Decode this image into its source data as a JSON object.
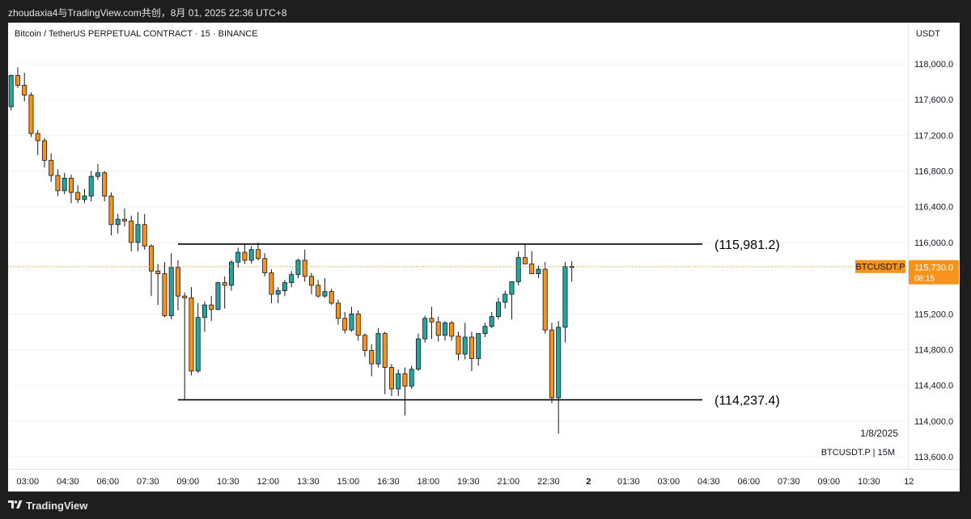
{
  "header": {
    "caption": "zhoudaxia4与TradingView.com共创，8月 01, 2025 22:36 UTC+8"
  },
  "chart_title": "Bitcoin / TetherUS PERPETUAL CONTRACT · 15 · BINANCE",
  "footer": {
    "brand": "TradingView"
  },
  "chart_data": {
    "type": "candlestick",
    "symbol": "BTCUSDT.P",
    "interval_label": "BTCUSDT.P | 15M",
    "currency": "USDT",
    "date_label": "1/8/2025",
    "last_price": {
      "value": 115730.0,
      "label": "115,730.0",
      "countdown": "08:15"
    },
    "y_ticks": [
      {
        "value": 118000,
        "label": "118,000.0"
      },
      {
        "value": 117600,
        "label": "117,600.0"
      },
      {
        "value": 117200,
        "label": "117,200.0"
      },
      {
        "value": 116800,
        "label": "116,800.0"
      },
      {
        "value": 116400,
        "label": "116,400.0"
      },
      {
        "value": 116000,
        "label": "116,000.0"
      },
      {
        "value": 115200,
        "label": "115,200.0"
      },
      {
        "value": 114800,
        "label": "114,800.0"
      },
      {
        "value": 114400,
        "label": "114,400.0"
      },
      {
        "value": 114000,
        "label": "114,000.0"
      },
      {
        "value": 113600,
        "label": "113,600.0"
      }
    ],
    "x_ticks": [
      {
        "index": 2.5,
        "label": "03:00",
        "bold": false
      },
      {
        "index": 8.5,
        "label": "04:30",
        "bold": false
      },
      {
        "index": 14.5,
        "label": "06:00",
        "bold": false
      },
      {
        "index": 20.5,
        "label": "07:30",
        "bold": false
      },
      {
        "index": 26.5,
        "label": "09:00",
        "bold": false
      },
      {
        "index": 32.5,
        "label": "10:30",
        "bold": false
      },
      {
        "index": 38.5,
        "label": "12:00",
        "bold": false
      },
      {
        "index": 44.5,
        "label": "13:30",
        "bold": false
      },
      {
        "index": 50.5,
        "label": "15:00",
        "bold": false
      },
      {
        "index": 56.5,
        "label": "16:30",
        "bold": false
      },
      {
        "index": 62.5,
        "label": "18:00",
        "bold": false
      },
      {
        "index": 68.5,
        "label": "19:30",
        "bold": false
      },
      {
        "index": 74.5,
        "label": "21:00",
        "bold": false
      },
      {
        "index": 80.5,
        "label": "22:30",
        "bold": false
      },
      {
        "index": 86.5,
        "label": "2",
        "bold": true
      },
      {
        "index": 92.5,
        "label": "01:30",
        "bold": false
      },
      {
        "index": 98.5,
        "label": "03:00",
        "bold": false
      },
      {
        "index": 104.5,
        "label": "04:30",
        "bold": false
      },
      {
        "index": 110.5,
        "label": "06:00",
        "bold": false
      },
      {
        "index": 116.5,
        "label": "07:30",
        "bold": false
      },
      {
        "index": 122.5,
        "label": "09:00",
        "bold": false
      },
      {
        "index": 128.5,
        "label": "10:30",
        "bold": false
      },
      {
        "index": 134.5,
        "label": "12",
        "bold": false
      }
    ],
    "levels": [
      {
        "value": 115981.2,
        "label": "(115,981.2)",
        "from_index": 25
      },
      {
        "value": 114237.4,
        "label": "(114,237.4)",
        "from_index": 25
      }
    ],
    "candles": [
      {
        "o": 117520,
        "h": 117880,
        "l": 117480,
        "c": 117870
      },
      {
        "o": 117870,
        "h": 117960,
        "l": 117730,
        "c": 117760
      },
      {
        "o": 117760,
        "h": 117900,
        "l": 117580,
        "c": 117650
      },
      {
        "o": 117650,
        "h": 117680,
        "l": 117180,
        "c": 117220
      },
      {
        "o": 117220,
        "h": 117260,
        "l": 116980,
        "c": 117140
      },
      {
        "o": 117140,
        "h": 117170,
        "l": 116840,
        "c": 116920
      },
      {
        "o": 116920,
        "h": 117000,
        "l": 116680,
        "c": 116750
      },
      {
        "o": 116750,
        "h": 116820,
        "l": 116520,
        "c": 116580
      },
      {
        "o": 116580,
        "h": 116780,
        "l": 116540,
        "c": 116720
      },
      {
        "o": 116720,
        "h": 116760,
        "l": 116440,
        "c": 116560
      },
      {
        "o": 116560,
        "h": 116640,
        "l": 116440,
        "c": 116480
      },
      {
        "o": 116480,
        "h": 116600,
        "l": 116440,
        "c": 116520
      },
      {
        "o": 116520,
        "h": 116800,
        "l": 116460,
        "c": 116740
      },
      {
        "o": 116740,
        "h": 116880,
        "l": 116700,
        "c": 116780
      },
      {
        "o": 116780,
        "h": 116800,
        "l": 116460,
        "c": 116520
      },
      {
        "o": 116520,
        "h": 116560,
        "l": 116080,
        "c": 116200
      },
      {
        "o": 116200,
        "h": 116320,
        "l": 116100,
        "c": 116260
      },
      {
        "o": 116260,
        "h": 116380,
        "l": 116180,
        "c": 116240
      },
      {
        "o": 116240,
        "h": 116300,
        "l": 115900,
        "c": 116000
      },
      {
        "o": 116000,
        "h": 116340,
        "l": 115900,
        "c": 116200
      },
      {
        "o": 116200,
        "h": 116320,
        "l": 115920,
        "c": 115960
      },
      {
        "o": 115960,
        "h": 115980,
        "l": 115400,
        "c": 115680
      },
      {
        "o": 115680,
        "h": 115760,
        "l": 115300,
        "c": 115650
      },
      {
        "o": 115650,
        "h": 115780,
        "l": 115160,
        "c": 115180
      },
      {
        "o": 115180,
        "h": 115880,
        "l": 115140,
        "c": 115720
      },
      {
        "o": 115720,
        "h": 115800,
        "l": 115240,
        "c": 115400
      },
      {
        "o": 115400,
        "h": 115440,
        "l": 114240,
        "c": 115380
      },
      {
        "o": 115380,
        "h": 115500,
        "l": 114510,
        "c": 114560
      },
      {
        "o": 114560,
        "h": 115320,
        "l": 114540,
        "c": 115160
      },
      {
        "o": 115160,
        "h": 115340,
        "l": 115000,
        "c": 115300
      },
      {
        "o": 115300,
        "h": 115400,
        "l": 115120,
        "c": 115250
      },
      {
        "o": 115250,
        "h": 115560,
        "l": 115240,
        "c": 115550
      },
      {
        "o": 115550,
        "h": 115620,
        "l": 115260,
        "c": 115520
      },
      {
        "o": 115520,
        "h": 115800,
        "l": 115460,
        "c": 115780
      },
      {
        "o": 115780,
        "h": 115940,
        "l": 115720,
        "c": 115890
      },
      {
        "o": 115890,
        "h": 115980,
        "l": 115760,
        "c": 115800
      },
      {
        "o": 115800,
        "h": 115960,
        "l": 115760,
        "c": 115920
      },
      {
        "o": 115920,
        "h": 116000,
        "l": 115800,
        "c": 115820
      },
      {
        "o": 115820,
        "h": 115880,
        "l": 115620,
        "c": 115660
      },
      {
        "o": 115660,
        "h": 115700,
        "l": 115320,
        "c": 115420
      },
      {
        "o": 115420,
        "h": 115500,
        "l": 115320,
        "c": 115460
      },
      {
        "o": 115460,
        "h": 115580,
        "l": 115400,
        "c": 115550
      },
      {
        "o": 115550,
        "h": 115680,
        "l": 115500,
        "c": 115640
      },
      {
        "o": 115640,
        "h": 115820,
        "l": 115600,
        "c": 115800
      },
      {
        "o": 115800,
        "h": 115920,
        "l": 115560,
        "c": 115620
      },
      {
        "o": 115620,
        "h": 115660,
        "l": 115420,
        "c": 115520
      },
      {
        "o": 115520,
        "h": 115580,
        "l": 115380,
        "c": 115400
      },
      {
        "o": 115400,
        "h": 115600,
        "l": 115380,
        "c": 115450
      },
      {
        "o": 115450,
        "h": 115480,
        "l": 115300,
        "c": 115320
      },
      {
        "o": 115320,
        "h": 115360,
        "l": 115080,
        "c": 115150
      },
      {
        "o": 115150,
        "h": 115220,
        "l": 114980,
        "c": 115020
      },
      {
        "o": 115020,
        "h": 115280,
        "l": 115000,
        "c": 115200
      },
      {
        "o": 115200,
        "h": 115240,
        "l": 114900,
        "c": 114960
      },
      {
        "o": 114960,
        "h": 114980,
        "l": 114720,
        "c": 114790
      },
      {
        "o": 114790,
        "h": 114860,
        "l": 114500,
        "c": 114640
      },
      {
        "o": 114640,
        "h": 115040,
        "l": 114600,
        "c": 114980
      },
      {
        "o": 114980,
        "h": 115000,
        "l": 114300,
        "c": 114600
      },
      {
        "o": 114600,
        "h": 114640,
        "l": 114280,
        "c": 114360
      },
      {
        "o": 114360,
        "h": 114580,
        "l": 114280,
        "c": 114530
      },
      {
        "o": 114530,
        "h": 114600,
        "l": 114060,
        "c": 114390
      },
      {
        "o": 114390,
        "h": 114620,
        "l": 114360,
        "c": 114580
      },
      {
        "o": 114580,
        "h": 114980,
        "l": 114560,
        "c": 114920
      },
      {
        "o": 114920,
        "h": 115180,
        "l": 114880,
        "c": 115150
      },
      {
        "o": 115150,
        "h": 115280,
        "l": 114920,
        "c": 115110
      },
      {
        "o": 115110,
        "h": 115170,
        "l": 114890,
        "c": 114960
      },
      {
        "o": 114960,
        "h": 115120,
        "l": 114900,
        "c": 115100
      },
      {
        "o": 115100,
        "h": 115120,
        "l": 114900,
        "c": 114950
      },
      {
        "o": 114950,
        "h": 115000,
        "l": 114680,
        "c": 114750
      },
      {
        "o": 114750,
        "h": 115100,
        "l": 114690,
        "c": 114940
      },
      {
        "o": 114940,
        "h": 115000,
        "l": 114560,
        "c": 114700
      },
      {
        "o": 114700,
        "h": 114980,
        "l": 114620,
        "c": 114980
      },
      {
        "o": 114980,
        "h": 115100,
        "l": 114940,
        "c": 115060
      },
      {
        "o": 115060,
        "h": 115220,
        "l": 115040,
        "c": 115170
      },
      {
        "o": 115170,
        "h": 115380,
        "l": 115140,
        "c": 115330
      },
      {
        "o": 115330,
        "h": 115460,
        "l": 115260,
        "c": 115420
      },
      {
        "o": 115420,
        "h": 115520,
        "l": 115140,
        "c": 115560
      },
      {
        "o": 115560,
        "h": 115900,
        "l": 115520,
        "c": 115830
      },
      {
        "o": 115830,
        "h": 115980,
        "l": 115780,
        "c": 115760
      },
      {
        "o": 115760,
        "h": 115900,
        "l": 115700,
        "c": 115650
      },
      {
        "o": 115650,
        "h": 115740,
        "l": 115600,
        "c": 115700
      },
      {
        "o": 115700,
        "h": 115780,
        "l": 114980,
        "c": 115020
      },
      {
        "o": 115020,
        "h": 115100,
        "l": 114200,
        "c": 114260
      },
      {
        "o": 114260,
        "h": 115120,
        "l": 113860,
        "c": 115050
      },
      {
        "o": 115050,
        "h": 115780,
        "l": 114880,
        "c": 115730
      },
      {
        "o": 115730,
        "h": 115790,
        "l": 115560,
        "c": 115730
      }
    ]
  }
}
